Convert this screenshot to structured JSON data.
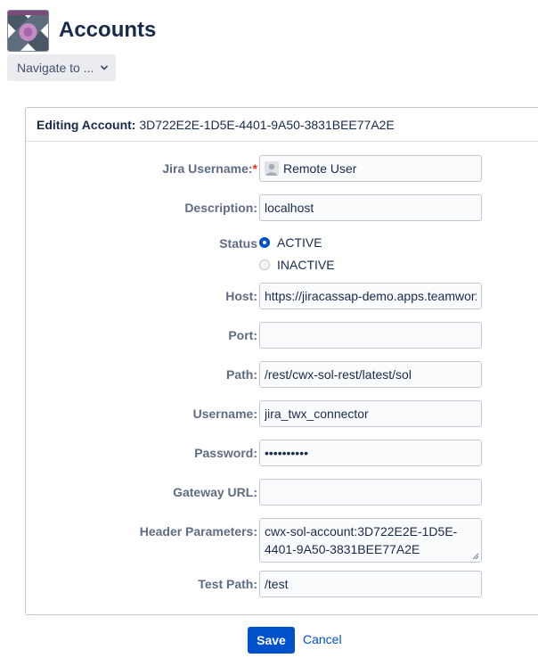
{
  "header": {
    "title": "Accounts",
    "logo_icon": "accounts-app-logo",
    "navigate_label": "Navigate to ...",
    "navigate_icon": "chevron-down-icon"
  },
  "panel": {
    "editing_label": "Editing Account:",
    "account_id": "3D722E2E-1D5E-4401-9A50-3831BEE77A2E"
  },
  "form": {
    "jira_username": {
      "label": "Jira Username:",
      "required_marker": "*",
      "value": "Remote User",
      "avatar_icon": "user-avatar-icon"
    },
    "description": {
      "label": "Description:",
      "value": "localhost"
    },
    "status": {
      "label": "Status",
      "options": [
        {
          "label": "ACTIVE",
          "selected": true
        },
        {
          "label": "INACTIVE",
          "selected": false
        }
      ]
    },
    "host": {
      "label": "Host:",
      "value": "https://jiracassap-demo.apps.teamworx.com"
    },
    "port": {
      "label": "Port:",
      "value": ""
    },
    "path": {
      "label": "Path:",
      "value": "/rest/cwx-sol-rest/latest/sol"
    },
    "username": {
      "label": "Username:",
      "value": "jira_twx_connector"
    },
    "password": {
      "label": "Password:",
      "value": "••••••••••"
    },
    "gateway_url": {
      "label": "Gateway URL:",
      "value": ""
    },
    "header_parameters": {
      "label": "Header Parameters:",
      "value": "cwx-sol-account:3D722E2E-1D5E-4401-9A50-3831BEE77A2E"
    },
    "test_path": {
      "label": "Test Path:",
      "value": "/test"
    }
  },
  "actions": {
    "save_label": "Save",
    "cancel_label": "Cancel"
  },
  "colors": {
    "primary": "#0052cc",
    "required": "#de350b",
    "label": "#5e6c84",
    "text": "#172b4d"
  }
}
